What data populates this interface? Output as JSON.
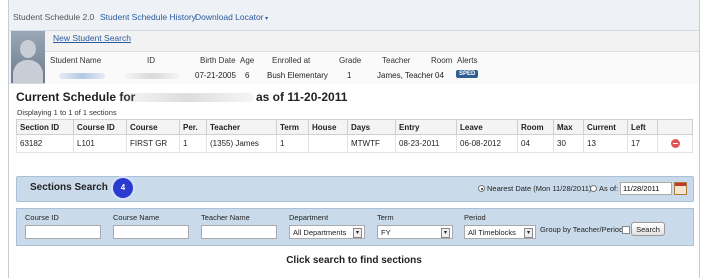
{
  "nav": {
    "app_title": "Student Schedule 2.0",
    "history_link": "Student Schedule History",
    "download_link": "Download Locator"
  },
  "student": {
    "new_search_link": "New Student Search",
    "headers": {
      "name": "Student Name",
      "id": "ID",
      "birth_date": "Birth Date",
      "age": "Age",
      "enrolled": "Enrolled at",
      "grade": "Grade",
      "teacher": "Teacher",
      "room": "Room",
      "alerts": "Alerts"
    },
    "values": {
      "birth_date": "07-21-2005",
      "age": "6",
      "enrolled": "Bush Elementary",
      "grade": "1",
      "teacher": "James, Teacher",
      "room": "04",
      "alert_badge": "SPED"
    }
  },
  "schedule": {
    "title_prefix": "Current Schedule for",
    "title_suffix": "as of 11-20-2011",
    "displaying": "Displaying 1 to 1 of 1 sections",
    "columns": [
      "Section ID",
      "Course ID",
      "Course",
      "Per.",
      "Teacher",
      "Term",
      "House",
      "Days",
      "Entry",
      "Leave",
      "Room",
      "Max",
      "Current",
      "Left"
    ],
    "rows": [
      [
        "63182",
        "L101",
        "FIRST GR",
        "1",
        "(1355) James",
        "1",
        "",
        "MTWTF",
        "08-23-2011",
        "06-08-2012",
        "04",
        "30",
        "13",
        "17"
      ]
    ]
  },
  "sections_search": {
    "title": "Sections Search",
    "step_number": "4",
    "nearest_date_label": "Nearest Date (Mon 11/28/2011)",
    "as_of_label": "As of:",
    "as_of_value": "11/28/2011"
  },
  "filters": {
    "course_id_label": "Course ID",
    "course_name_label": "Course Name",
    "teacher_name_label": "Teacher Name",
    "department_label": "Department",
    "department_value": "All Departments",
    "term_label": "Term",
    "term_value": "FY",
    "period_label": "Period",
    "period_value": "All Timeblocks",
    "group_label": "Group by Teacher/Period",
    "search_button": "Search"
  },
  "footer_message": "Click search to find sections",
  "colors": {
    "link": "#2a5aa0",
    "panel_blue": "#c9dbeb",
    "badge_blue": "#2b3bd0",
    "sped_badge": "#2f5f92",
    "remove_red": "#e05555"
  }
}
